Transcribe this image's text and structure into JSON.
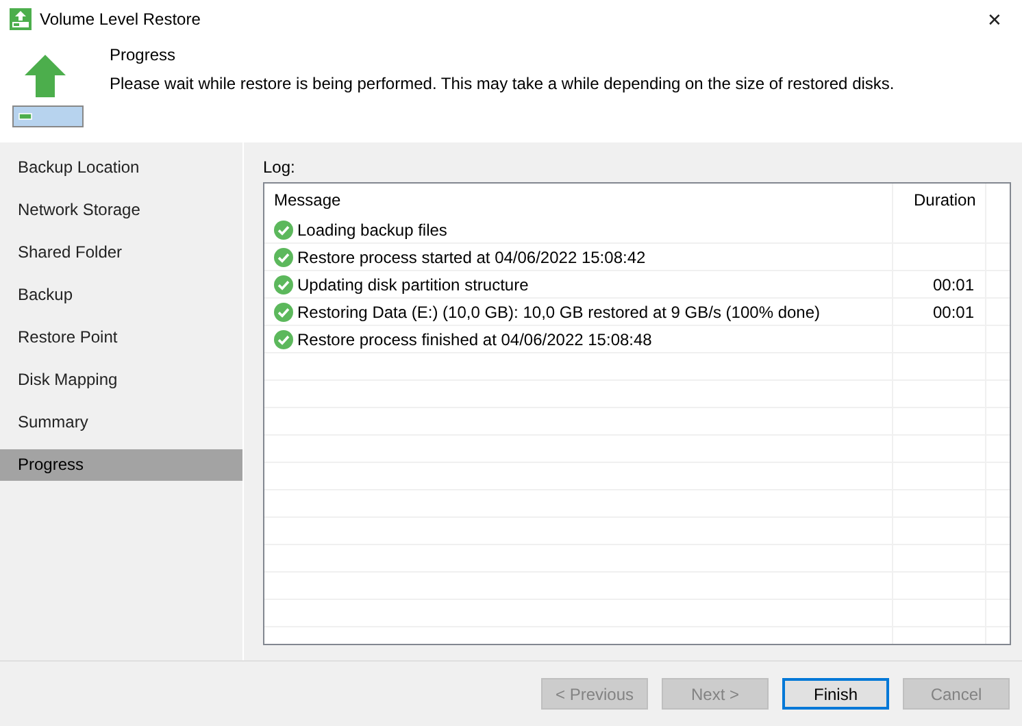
{
  "window": {
    "title": "Volume Level Restore",
    "close": "✕"
  },
  "header": {
    "title": "Progress",
    "description": "Please wait while restore is being performed. This may take a while depending on the size of restored disks."
  },
  "sidebar": {
    "items": [
      {
        "label": "Backup Location",
        "selected": false
      },
      {
        "label": "Network Storage",
        "selected": false
      },
      {
        "label": "Shared Folder",
        "selected": false
      },
      {
        "label": "Backup",
        "selected": false
      },
      {
        "label": "Restore Point",
        "selected": false
      },
      {
        "label": "Disk Mapping",
        "selected": false
      },
      {
        "label": "Summary",
        "selected": false
      },
      {
        "label": "Progress",
        "selected": true
      }
    ]
  },
  "log": {
    "label": "Log:",
    "columns": [
      "Message",
      "Duration"
    ],
    "rows": [
      {
        "completed": true,
        "message": "Loading backup files"
      },
      {
        "completed": true,
        "message": "Restore process started at 04/06/2022 15:08:42"
      },
      {
        "completed": true,
        "message": "Updating disk partition structure",
        "duration": "00:01"
      },
      {
        "completed": true,
        "message": "Restoring Data (E:) (10,0 GB): 10,0 GB restored at 9 GB/s (100% done)",
        "duration": "00:01"
      },
      {
        "completed": true,
        "message": "Restore process finished at 04/06/2022 15:08:48"
      }
    ]
  },
  "buttons": [
    {
      "label": "< Previous",
      "disabled": true,
      "default": false
    },
    {
      "label": "Next >",
      "disabled": true,
      "default": false
    },
    {
      "label": "Finish",
      "disabled": false,
      "default": true
    },
    {
      "label": "Cancel",
      "disabled": true,
      "default": false
    }
  ]
}
